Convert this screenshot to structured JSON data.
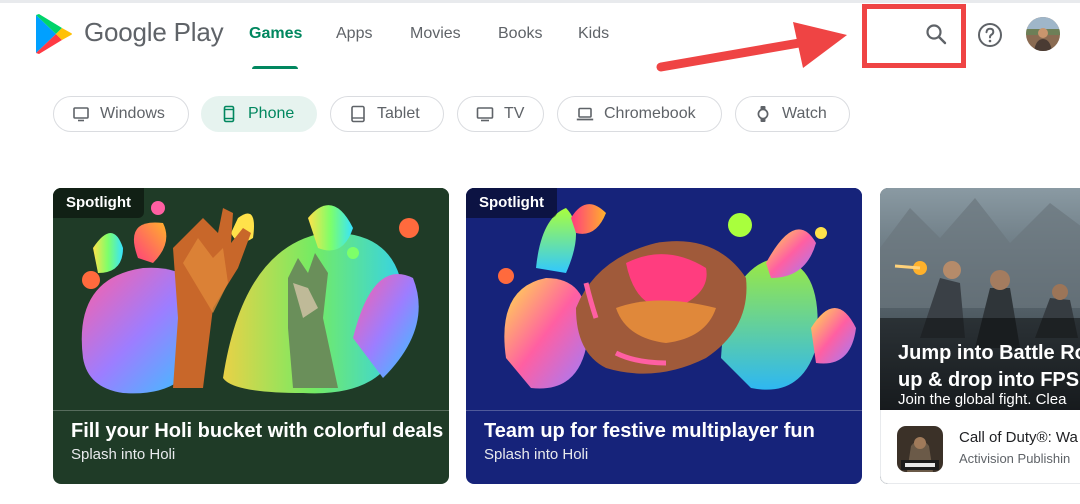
{
  "brand": {
    "name": "Google Play"
  },
  "nav": {
    "tabs": [
      "Games",
      "Apps",
      "Movies",
      "Books",
      "Kids"
    ],
    "active": "Games"
  },
  "header": {
    "search_icon": "search-icon",
    "help_icon": "help-icon",
    "avatar": "avatar"
  },
  "device_chips": [
    {
      "label": "Windows",
      "icon": "monitor-icon"
    },
    {
      "label": "Phone",
      "icon": "phone-icon",
      "selected": true
    },
    {
      "label": "Tablet",
      "icon": "tablet-icon"
    },
    {
      "label": "TV",
      "icon": "tv-icon"
    },
    {
      "label": "Chromebook",
      "icon": "laptop-icon"
    },
    {
      "label": "Watch",
      "icon": "watch-icon"
    }
  ],
  "cards": [
    {
      "badge": "Spotlight",
      "title": "Fill your Holi bucket with colorful deals",
      "subtitle": "Splash into Holi"
    },
    {
      "badge": "Spotlight",
      "title": "Team up for festive multiplayer fun",
      "subtitle": "Splash into Holi"
    },
    {
      "title_line1": "Jump into Battle Roy",
      "title_line2": "up & drop into FPS m",
      "subtitle": "Join the global fight. Clea",
      "app_name": "Call of Duty®: Wa",
      "developer": "Activision Publishin"
    }
  ],
  "colors": {
    "accent": "#01875f",
    "chip_selected_bg": "#e6f3ef",
    "annotation_red": "#ef4444",
    "card1_bg": "#1f3b27",
    "card2_bg": "#16237a"
  }
}
